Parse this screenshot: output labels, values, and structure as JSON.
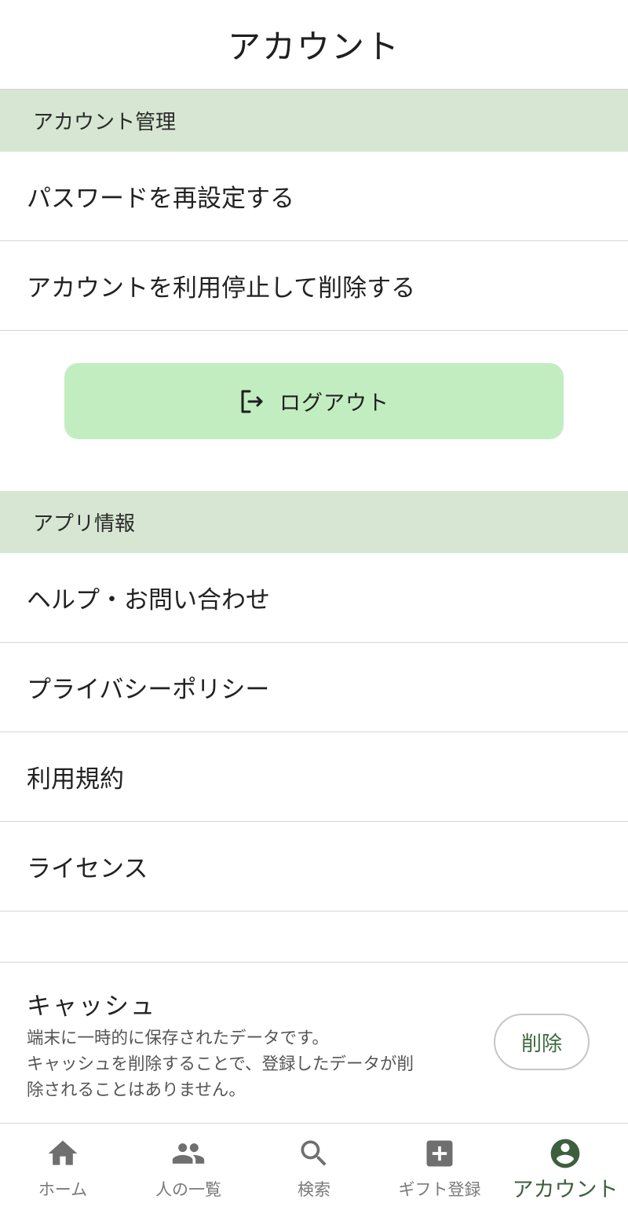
{
  "header": {
    "title": "アカウント"
  },
  "sections": {
    "account_management": {
      "title": "アカウント管理",
      "items": [
        {
          "label": "パスワードを再設定する"
        },
        {
          "label": "アカウントを利用停止して削除する"
        }
      ]
    },
    "app_info": {
      "title": "アプリ情報",
      "items": [
        {
          "label": "ヘルプ・お問い合わせ"
        },
        {
          "label": "プライバシーポリシー"
        },
        {
          "label": "利用規約"
        },
        {
          "label": "ライセンス"
        }
      ]
    }
  },
  "logout": {
    "label": "ログアウト",
    "icon": "logout-icon"
  },
  "cache": {
    "title": "キャッシュ",
    "description_lines": [
      "端末に一時的に保存されたデータです。",
      "キャッシュを削除することで、登録したデータが削",
      "除されることはありません。"
    ],
    "delete_label": "削除"
  },
  "tabbar": {
    "tabs": [
      {
        "label": "ホーム",
        "icon": "home-icon",
        "active": false
      },
      {
        "label": "人の一覧",
        "icon": "people-icon",
        "active": false
      },
      {
        "label": "検索",
        "icon": "search-icon",
        "active": false
      },
      {
        "label": "ギフト登録",
        "icon": "add-box-icon",
        "active": false
      },
      {
        "label": "アカウント",
        "icon": "account-circle-icon",
        "active": true
      }
    ]
  },
  "colors": {
    "section_bg": "#d7e6d2",
    "logout_bg": "#c2edc0",
    "active_tab": "#3e5f3e",
    "inactive_tab": "#7a7a7a"
  }
}
